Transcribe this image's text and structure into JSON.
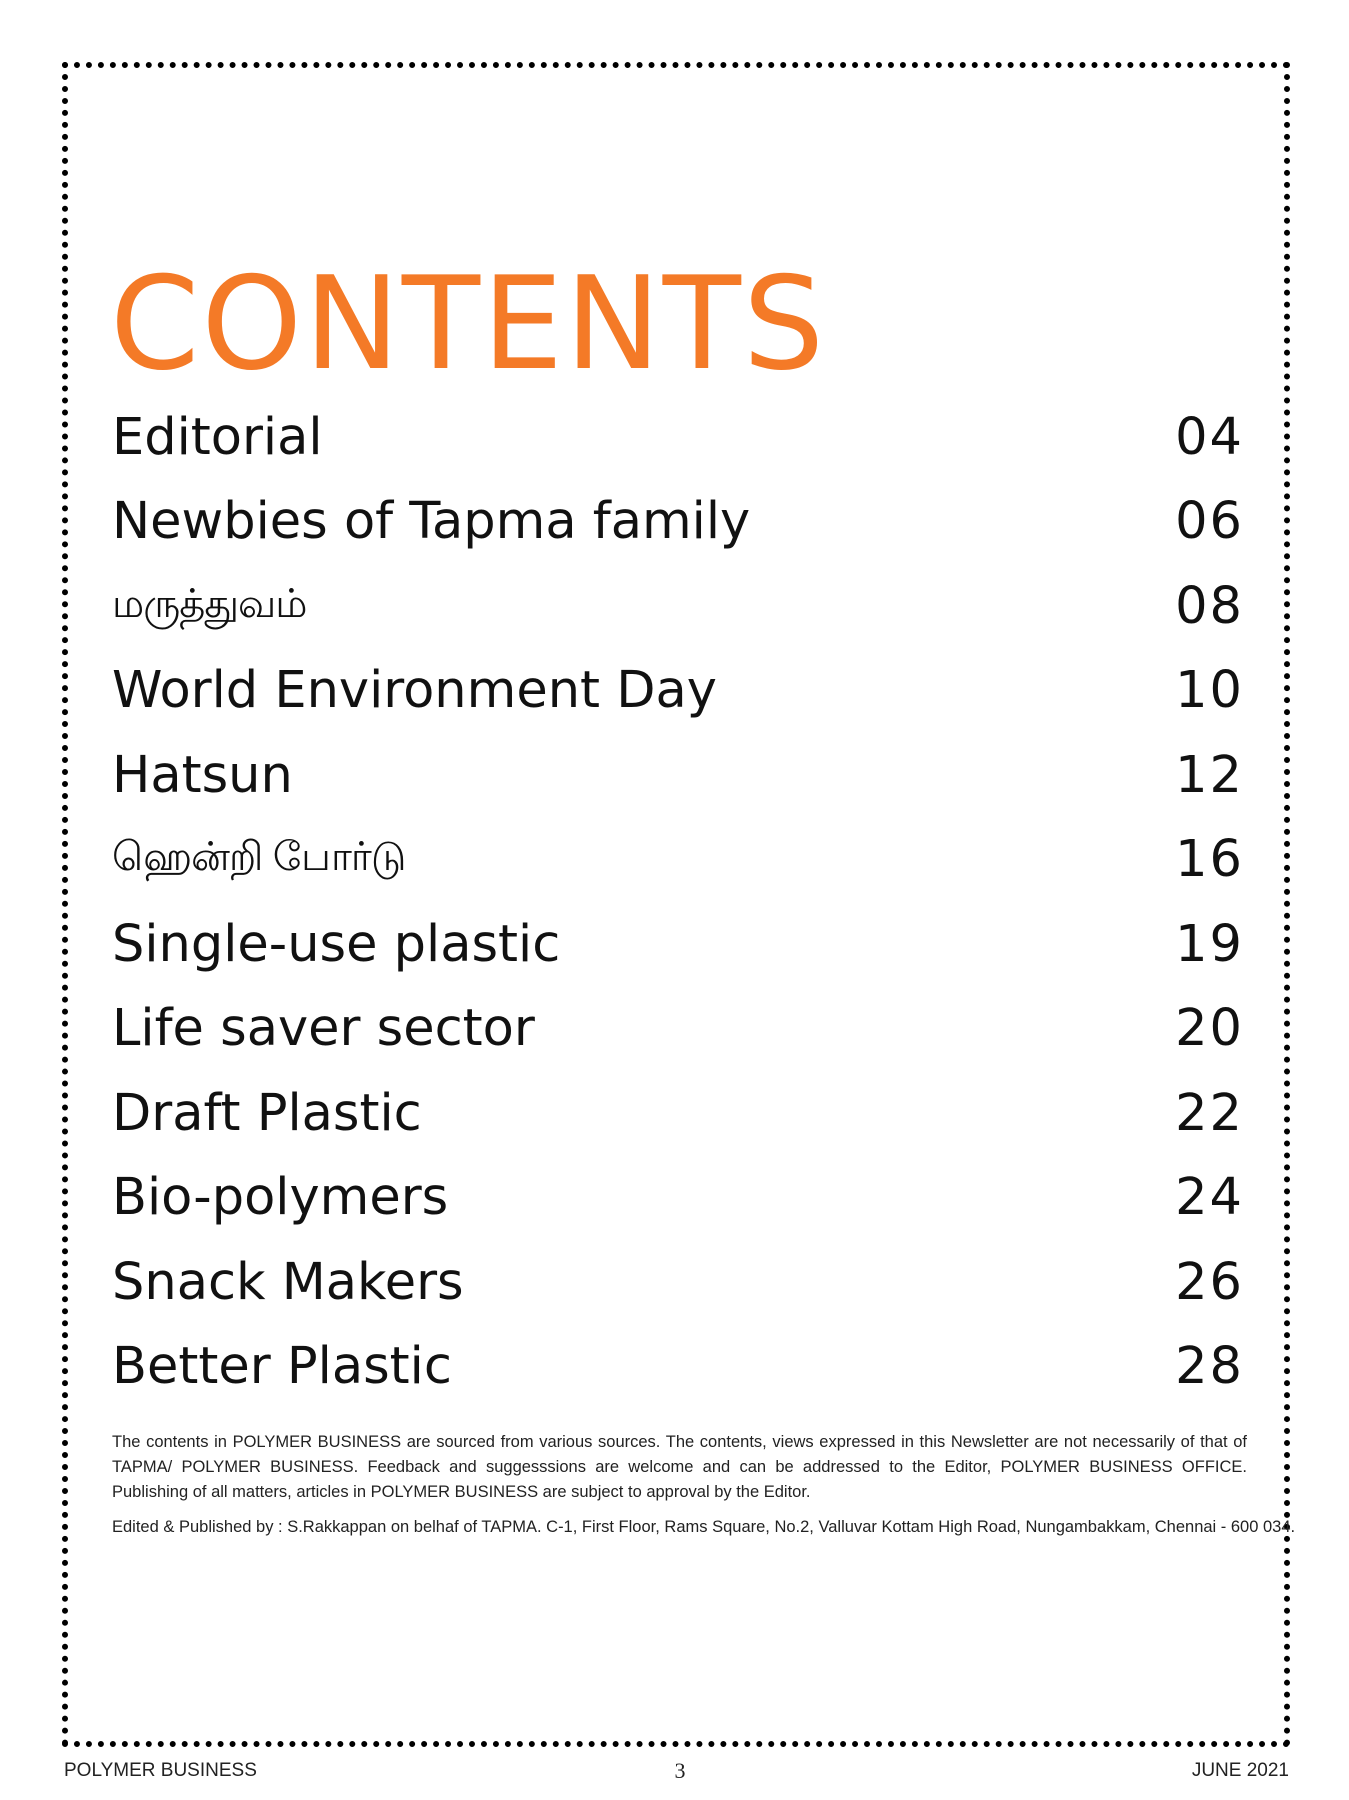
{
  "title": "CONTENTS",
  "accent_color": "#f47a27",
  "toc": [
    {
      "label": "Editorial",
      "page": "04"
    },
    {
      "label": "Newbies of Tapma family",
      "page": "06"
    },
    {
      "label": "மருத்துவம்",
      "page": "08"
    },
    {
      "label": "World Environment Day",
      "page": "10"
    },
    {
      "label": "Hatsun",
      "page": "12"
    },
    {
      "label": "ஹென்றி போர்டு",
      "page": "16"
    },
    {
      "label": "Single-use plastic",
      "page": "19"
    },
    {
      "label": "Life saver sector",
      "page": "20"
    },
    {
      "label": "Draft Plastic",
      "page": "22"
    },
    {
      "label": "Bio-polymers",
      "page": "24"
    },
    {
      "label": "Snack Makers",
      "page": "26"
    },
    {
      "label": "Better Plastic",
      "page": "28"
    }
  ],
  "disclaimer": "The contents in POLYMER BUSINESS are sourced from various sources. The contents, views expressed in this Newsletter are not necessarily of that of TAPMA/ POLYMER BUSINESS. Feedback and suggesssions are welcome and can be addressed to the Editor, POLYMER BUSINESS OFFICE. Publishing of all matters, articles in POLYMER BUSINESS are subject to approval by the Editor.",
  "publisher": "Edited & Published by : S.Rakkappan on belhaf of TAPMA. C-1, First Floor, Rams Square, No.2, Valluvar Kottam High Road, Nungambakkam, Chennai - 600 034.",
  "footer": {
    "left": "POLYMER BUSINESS",
    "page_number": "3",
    "right": "JUNE 2021"
  }
}
